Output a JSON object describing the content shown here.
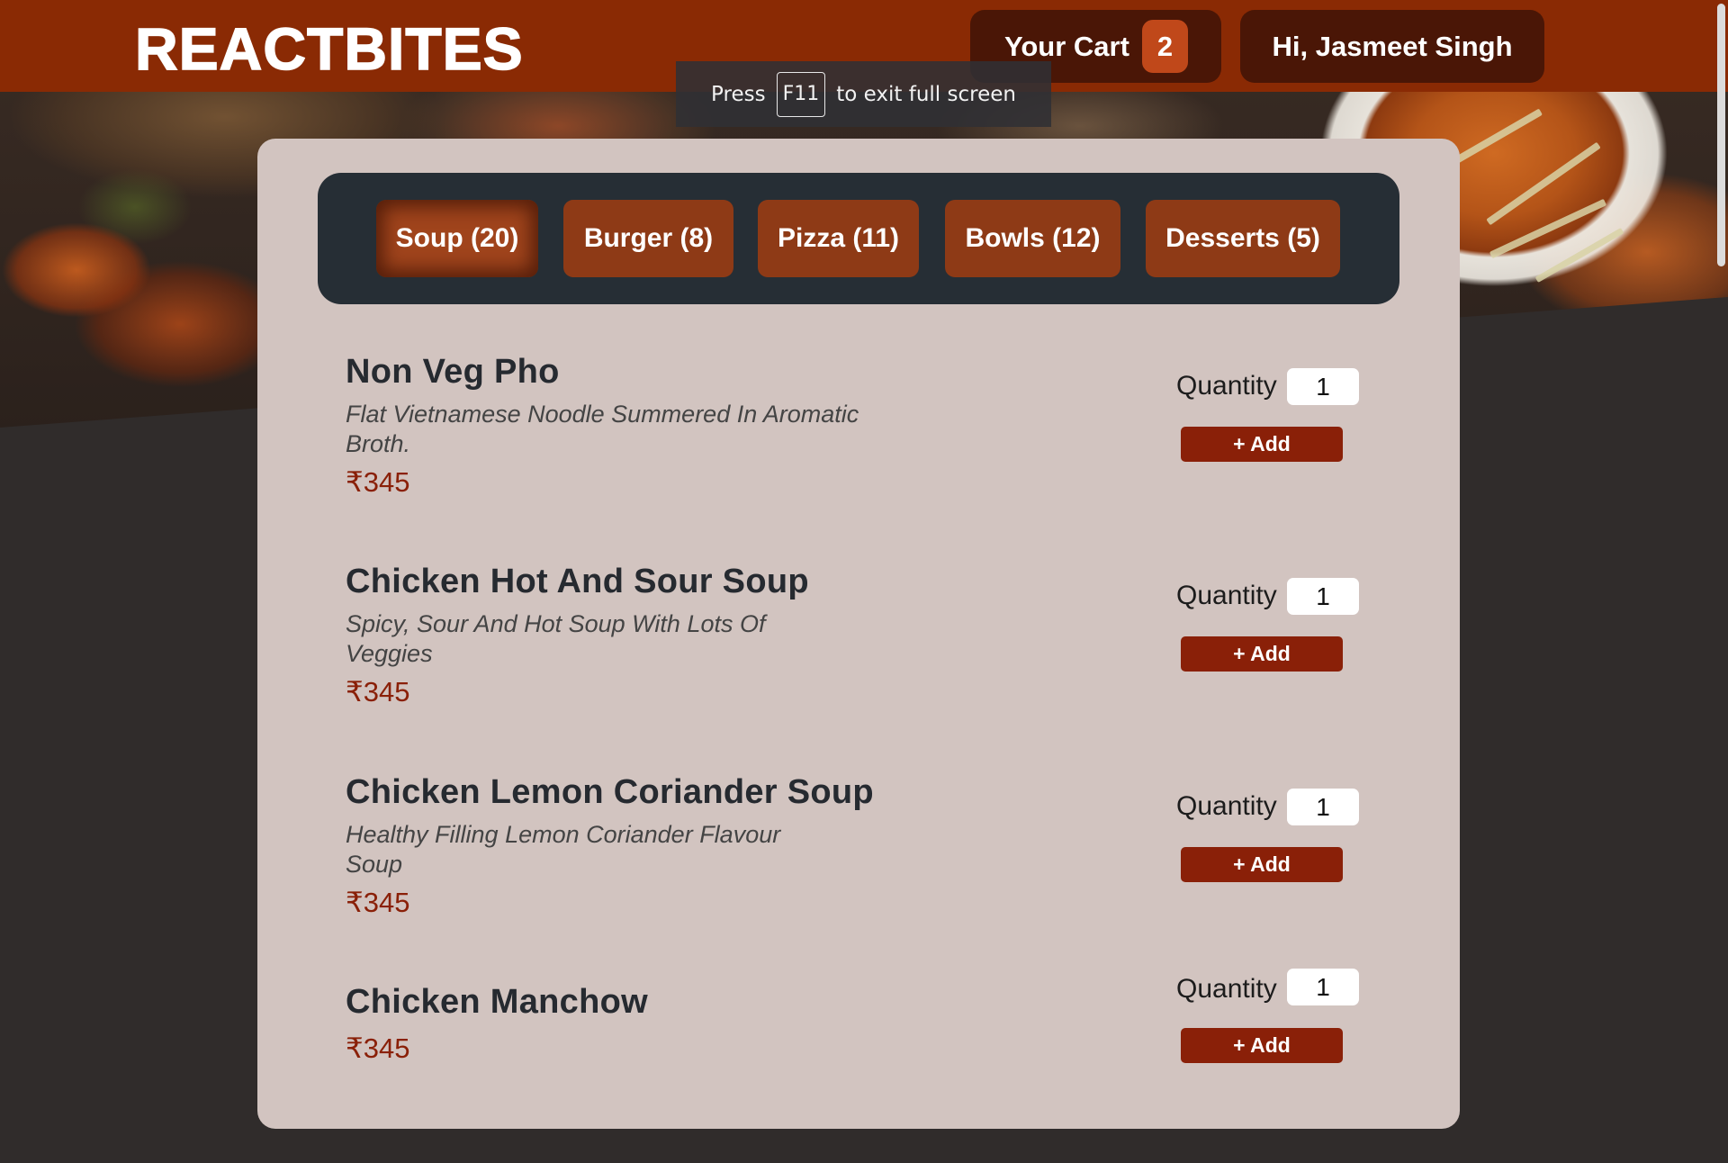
{
  "header": {
    "logo": "REACTBITES",
    "cart_label": "Your Cart",
    "cart_count": "2",
    "user_greeting": "Hi, Jasmeet Singh",
    "bg_color": "#8a2a04"
  },
  "fullscreen_toast": {
    "press": "Press",
    "key": "F11",
    "message": "to exit full screen"
  },
  "tabs": [
    {
      "label": "Soup (20)",
      "active": true
    },
    {
      "label": "Burger (8)",
      "active": false
    },
    {
      "label": "Pizza (11)",
      "active": false
    },
    {
      "label": "Bowls (12)",
      "active": false
    },
    {
      "label": "Desserts (5)",
      "active": false
    }
  ],
  "menu_items": [
    {
      "name": "Non Veg Pho",
      "description": "Flat Vietnamese Noodle Summered In Aromatic Broth.",
      "price": "₹345",
      "quantity_label": "Quantity",
      "quantity": "1",
      "add_label": "+ Add"
    },
    {
      "name": "Chicken Hot And Sour Soup",
      "description": "Spicy, Sour And Hot Soup With Lots Of Veggies",
      "price": "₹345",
      "quantity_label": "Quantity",
      "quantity": "1",
      "add_label": "+ Add"
    },
    {
      "name": "Chicken Lemon Coriander Soup",
      "description": "Healthy Filling Lemon Coriander Flavour Soup",
      "price": "₹345",
      "quantity_label": "Quantity",
      "quantity": "1",
      "add_label": "+ Add"
    },
    {
      "name": "Chicken Manchow",
      "description": "",
      "price": "₹345",
      "quantity_label": "Quantity",
      "quantity": "1",
      "add_label": "+ Add"
    }
  ],
  "colors": {
    "accent": "#8a2008",
    "card_bg": "#d2c4c0",
    "tabs_bg": "#262e35",
    "tab_bg": "#8e3a16",
    "page_bg": "#302c2b"
  }
}
